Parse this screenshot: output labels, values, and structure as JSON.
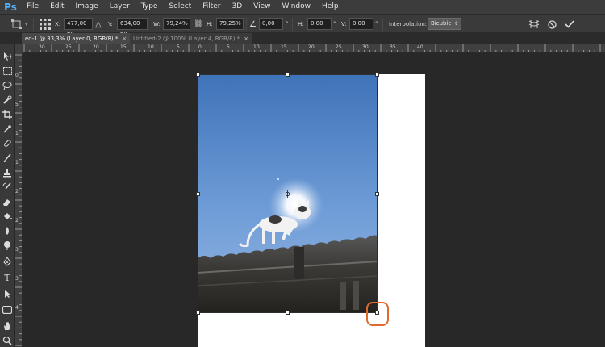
{
  "app": {
    "logo": "Ps"
  },
  "menu": [
    "File",
    "Edit",
    "Image",
    "Layer",
    "Type",
    "Select",
    "Filter",
    "3D",
    "View",
    "Window",
    "Help"
  ],
  "options": {
    "x_label": "X:",
    "x_value": "477,00 px",
    "y_label": "Y:",
    "y_value": "634,00 px",
    "w_label": "W:",
    "w_value": "79,24%",
    "h_label": "H:",
    "h_value": "79,25%",
    "angle_value": "0,00",
    "angle_unit": "°",
    "hskew_label": "H:",
    "hskew_value": "0,00",
    "hskew_unit": "°",
    "vskew_label": "V:",
    "vskew_value": "0,00",
    "vskew_unit": "°",
    "interp_label": "Interpolation:",
    "interp_value": "Bicubic"
  },
  "tabs": [
    {
      "label": "ed-1 @ 33,3% (Layer 0, RGB/8) *",
      "close": "×"
    },
    {
      "label": "Untitled-2 @ 100% (Layer 4, RGB/8) *",
      "close": "×"
    }
  ],
  "ruler_top": [
    "30",
    "25",
    "20",
    "15",
    "10",
    "5",
    "0",
    "5",
    "10",
    "15",
    "20",
    "25",
    "30",
    "35",
    "40"
  ],
  "ruler_left": [
    "0",
    "5",
    "1",
    "1",
    "2",
    "2",
    "3",
    "3",
    "4"
  ],
  "colors": {
    "accent": "#4fb2ff",
    "highlight": "#e06a2c",
    "canvas_bg": "#282828",
    "doc_bg": "#ffffff"
  }
}
